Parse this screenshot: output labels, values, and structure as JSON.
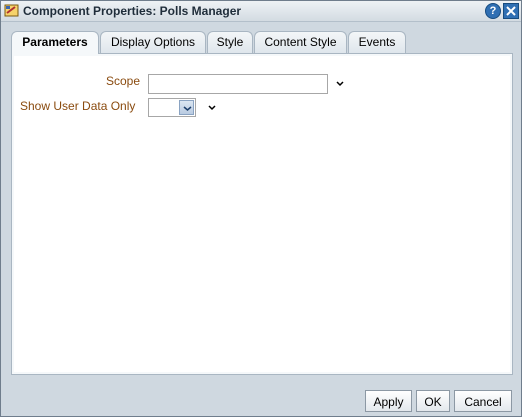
{
  "window": {
    "title": "Component Properties: Polls Manager",
    "icons": {
      "app": "properties-icon",
      "help": "help-icon",
      "close": "close-icon"
    }
  },
  "tabs": [
    {
      "label": "Parameters",
      "active": true
    },
    {
      "label": "Display Options",
      "active": false
    },
    {
      "label": "Style",
      "active": false
    },
    {
      "label": "Content Style",
      "active": false
    },
    {
      "label": "Events",
      "active": false
    }
  ],
  "form": {
    "scope": {
      "label": "Scope",
      "value": ""
    },
    "show_user_data_only": {
      "label": "Show User Data Only",
      "value": ""
    }
  },
  "buttons": {
    "apply": "Apply",
    "ok": "OK",
    "cancel": "Cancel"
  },
  "colors": {
    "label": "#8a4b0f",
    "accent": "#2f6fb3"
  }
}
